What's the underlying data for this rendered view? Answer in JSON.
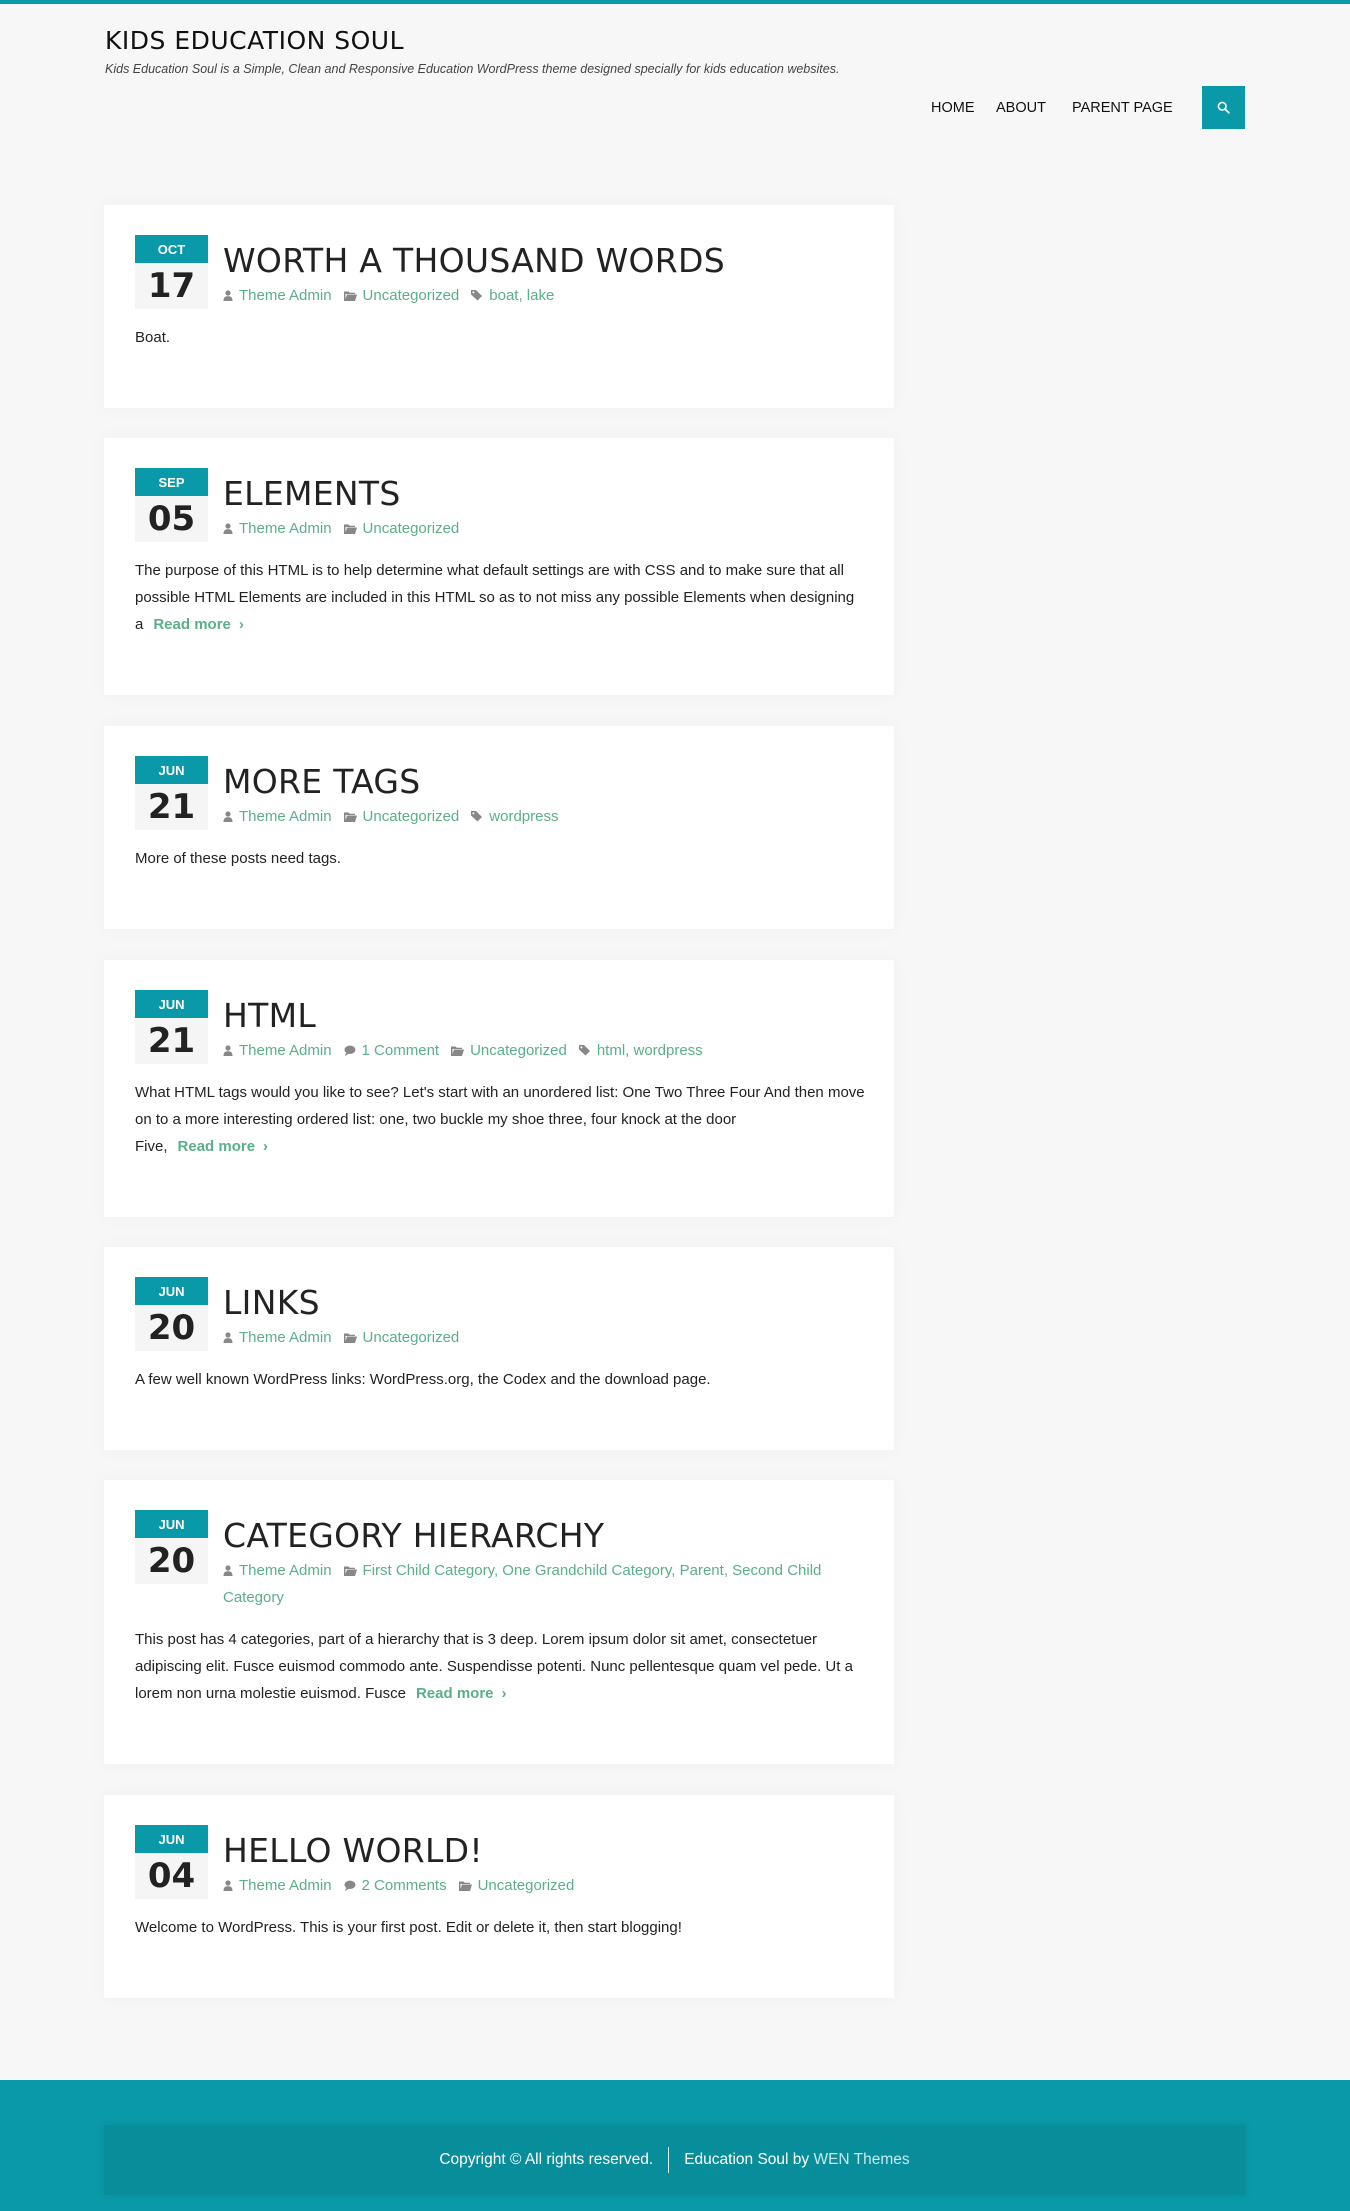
{
  "site": {
    "title": "KIDS EDUCATION SOUL",
    "description": "Kids Education Soul is a Simple, Clean and Responsive Education WordPress theme designed specially for kids education websites.",
    "accent_color": "#0a99a8",
    "link_color": "#5aaf8a"
  },
  "nav": {
    "items": [
      "HOME",
      "ABOUT",
      "PARENT PAGE"
    ],
    "search_icon": "search-icon"
  },
  "posts": [
    {
      "month": "OCT",
      "day": "17",
      "title": "WORTH A THOUSAND WORDS",
      "author": "Theme Admin",
      "comments": "",
      "categories": "Uncategorized",
      "tags": "boat, lake",
      "excerpt": "Boat.",
      "read_more": ""
    },
    {
      "month": "SEP",
      "day": "05",
      "title": "ELEMENTS",
      "author": "Theme Admin",
      "comments": "",
      "categories": "Uncategorized",
      "tags": "",
      "excerpt": "The purpose of this HTML is to help determine what default settings are with CSS and to make sure that all possible HTML Elements are included in this HTML so as to not miss any possible Elements when designing a",
      "read_more": "Read more"
    },
    {
      "month": "JUN",
      "day": "21",
      "title": "MORE TAGS",
      "author": "Theme Admin",
      "comments": "",
      "categories": "Uncategorized",
      "tags": "wordpress",
      "excerpt": "More of these posts need tags.",
      "read_more": ""
    },
    {
      "month": "JUN",
      "day": "21",
      "title": "HTML",
      "author": "Theme Admin",
      "comments": "1 Comment",
      "categories": "Uncategorized",
      "tags": "html, wordpress",
      "excerpt": "What HTML tags would you like to see? Let's start with an unordered list: One Two Three Four And then move on to a more interesting ordered list: one, two buckle my shoe three, four knock at the door Five,",
      "read_more": "Read more"
    },
    {
      "month": "JUN",
      "day": "20",
      "title": "LINKS",
      "author": "Theme Admin",
      "comments": "",
      "categories": "Uncategorized",
      "tags": "",
      "excerpt": "A few well known WordPress links: WordPress.org, the Codex and the download page.",
      "read_more": ""
    },
    {
      "month": "JUN",
      "day": "20",
      "title": "CATEGORY HIERARCHY",
      "author": "Theme Admin",
      "comments": "",
      "categories": "First Child Category, One Grandchild Category, Parent, Second Child Category",
      "tags": "",
      "excerpt": "This post has 4 categories, part of a hierarchy that is 3 deep. Lorem ipsum dolor sit amet, consectetuer adipiscing elit. Fusce euismod commodo ante. Suspendisse potenti. Nunc pellentesque quam vel pede. Ut a lorem non urna molestie euismod. Fusce",
      "read_more": "Read more"
    },
    {
      "month": "JUN",
      "day": "04",
      "title": "HELLO WORLD!",
      "author": "Theme Admin",
      "comments": "2 Comments",
      "categories": "Uncategorized",
      "tags": "",
      "excerpt": "Welcome to WordPress. This is your first post. Edit or delete it, then start blogging!",
      "read_more": ""
    }
  ],
  "footer": {
    "copyright": "Copyright © All rights reserved.",
    "theme_prefix": "Education Soul by",
    "theme_author": "WEN Themes"
  }
}
